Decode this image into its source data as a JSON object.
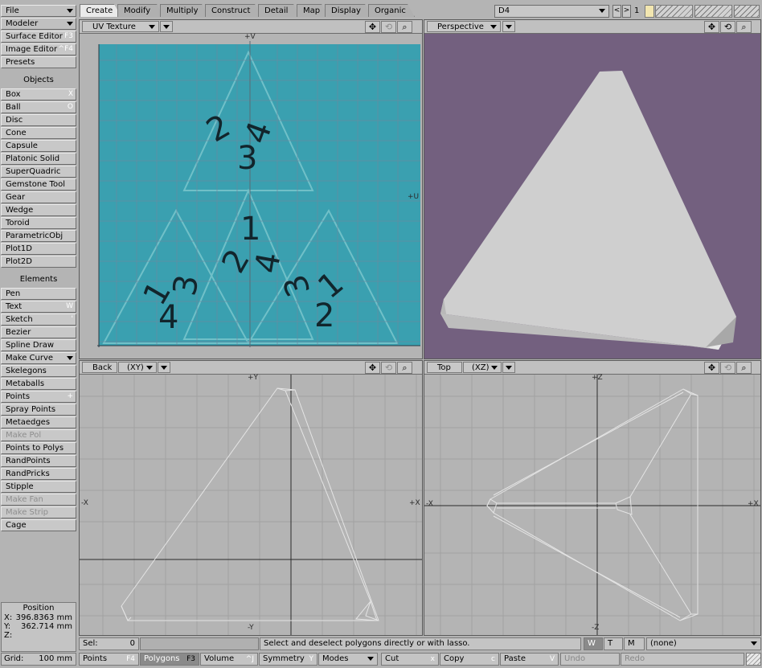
{
  "sidebar": {
    "file_label": "File",
    "modeler_label": "Modeler",
    "surface_editor": {
      "label": "Surface Editor",
      "key": "F3"
    },
    "image_editor": {
      "label": "Image Editor",
      "key": "^F4"
    },
    "presets_label": "Presets",
    "objects_heading": "Objects",
    "objects": [
      {
        "label": "Box",
        "key": "X"
      },
      {
        "label": "Ball",
        "key": "O"
      },
      {
        "label": "Disc",
        "key": ""
      },
      {
        "label": "Cone",
        "key": ""
      },
      {
        "label": "Capsule",
        "key": ""
      },
      {
        "label": "Platonic Solid",
        "key": ""
      },
      {
        "label": "SuperQuadric",
        "key": ""
      },
      {
        "label": "Gemstone Tool",
        "key": ""
      },
      {
        "label": "Gear",
        "key": ""
      },
      {
        "label": "Wedge",
        "key": ""
      },
      {
        "label": "Toroid",
        "key": ""
      },
      {
        "label": "ParametricObj",
        "key": ""
      },
      {
        "label": "Plot1D",
        "key": ""
      },
      {
        "label": "Plot2D",
        "key": ""
      }
    ],
    "elements_heading": "Elements",
    "elements": [
      {
        "label": "Pen",
        "key": ""
      },
      {
        "label": "Text",
        "key": "W"
      },
      {
        "label": "Sketch",
        "key": "'"
      },
      {
        "label": "Bezier",
        "key": ""
      },
      {
        "label": "Spline Draw",
        "key": ""
      },
      {
        "label": "Make Curve",
        "key": ""
      },
      {
        "label": "Skelegons",
        "key": ""
      },
      {
        "label": "Metaballs",
        "key": ""
      },
      {
        "label": "Points",
        "key": "+"
      },
      {
        "label": "Spray Points",
        "key": ""
      },
      {
        "label": "Metaedges",
        "key": ""
      },
      {
        "label": "Make Pol",
        "key": ""
      },
      {
        "label": "Points to Polys",
        "key": ""
      },
      {
        "label": "RandPoints",
        "key": ""
      },
      {
        "label": "RandPricks",
        "key": ""
      },
      {
        "label": "Stipple",
        "key": ""
      },
      {
        "label": "Make Fan",
        "key": ""
      },
      {
        "label": "Make Strip",
        "key": ""
      },
      {
        "label": "Cage",
        "key": ""
      }
    ],
    "position": {
      "title": "Position",
      "x_label": "X:",
      "x_value": "396.8363 mm",
      "y_label": "Y:",
      "y_value": "362.714 mm",
      "z_label": "Z:",
      "z_value": ""
    },
    "grid": {
      "label": "Grid:",
      "value": "100 mm"
    }
  },
  "tabs": [
    "Create",
    "Modify",
    "Multiply",
    "Construct",
    "Detail",
    "Map",
    "Display",
    "Organic"
  ],
  "top_right": {
    "layer_name": "D4",
    "layer_number": "1"
  },
  "viewports": {
    "uv": {
      "title": "UV Texture",
      "axis_top": "+V",
      "axis_right": "+U"
    },
    "perspective": {
      "title": "Perspective"
    },
    "back": {
      "title": "Back",
      "mode": "(XY)",
      "axis_top": "+Y",
      "axis_bottom": "-Y",
      "axis_left": "-X",
      "axis_right": "+X"
    },
    "top": {
      "title": "Top",
      "mode": "(XZ)",
      "axis_top": "+Z",
      "axis_bottom": "-Z",
      "axis_left": "-X",
      "axis_right": "+X"
    }
  },
  "uv_texture_numbers": [
    "2",
    "4",
    "3",
    "1",
    "2",
    "4",
    "1",
    "3",
    "4",
    "3",
    "1",
    "2"
  ],
  "status": {
    "sel_label": "Sel:",
    "sel_value": "0",
    "message": "Select and deselect polygons directly or with lasso.",
    "w": "W",
    "t": "T",
    "m": "M",
    "surface": "(none)"
  },
  "bottom_bar": {
    "points": {
      "label": "Points",
      "key": "F4"
    },
    "polygons": {
      "label": "Polygons",
      "key": "F3"
    },
    "volume": {
      "label": "Volume",
      "key": "^J"
    },
    "symmetry": {
      "label": "Symmetry",
      "key": "Y"
    },
    "modes": {
      "label": "Modes"
    },
    "cut": {
      "label": "Cut",
      "key": "x"
    },
    "copy": {
      "label": "Copy",
      "key": "c"
    },
    "paste": {
      "label": "Paste",
      "key": "V"
    },
    "undo": {
      "label": "Undo"
    },
    "redo": {
      "label": "Redo"
    }
  },
  "colors": {
    "uv_background": "#3aa0b0",
    "perspective_background": "#73607f",
    "ortho_background": "#b4b4b4",
    "mesh": "#d0d0d0"
  }
}
